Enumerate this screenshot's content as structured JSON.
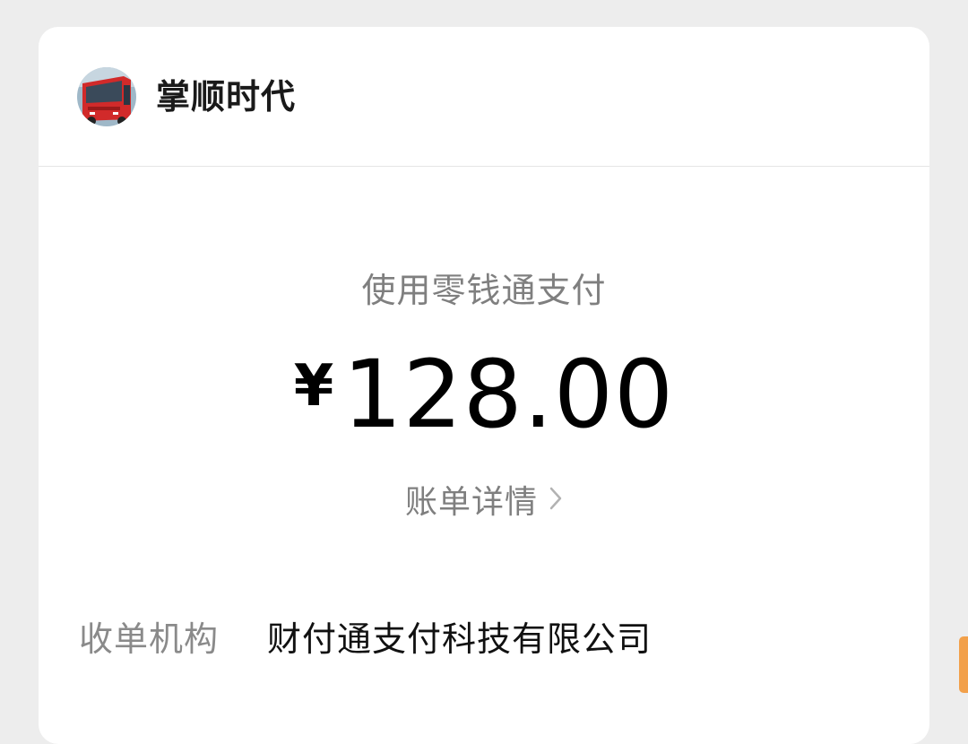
{
  "merchant": {
    "name": "掌顺时代",
    "avatar_icon": "bus-avatar-icon"
  },
  "payment": {
    "method": "使用零钱通支付",
    "currency_symbol": "¥",
    "amount": "128.00"
  },
  "bill_detail": {
    "label": "账单详情",
    "icon": "chevron-right-icon"
  },
  "info": [
    {
      "label": "收单机构",
      "value": "财付通支付科技有限公司"
    }
  ],
  "colors": {
    "background": "#ededed",
    "card": "#ffffff",
    "accent_scroll": "#f2a04a"
  }
}
